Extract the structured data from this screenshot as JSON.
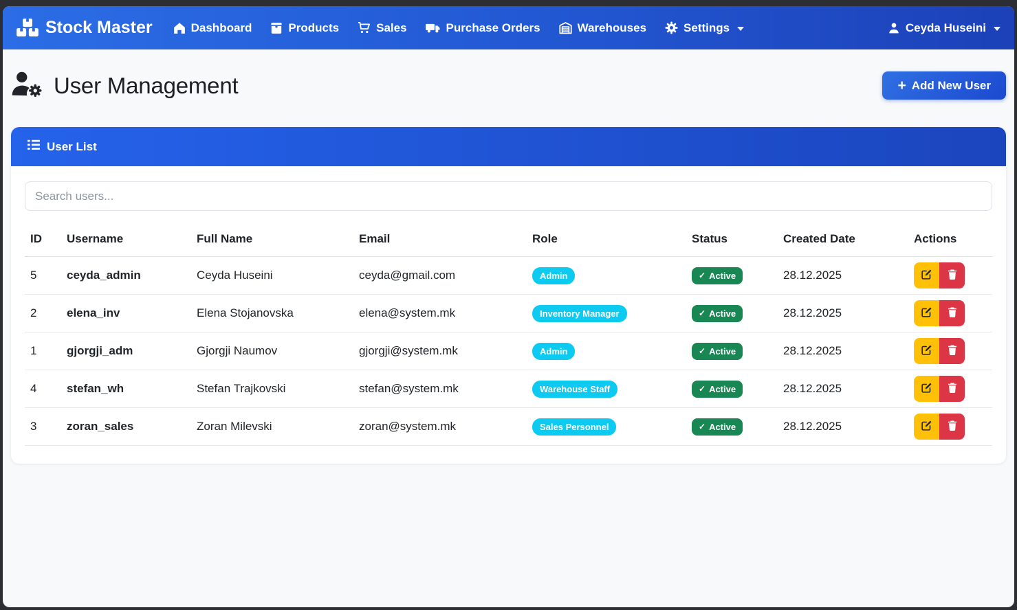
{
  "navbar": {
    "brand": "Stock Master",
    "items": [
      {
        "label": "Dashboard",
        "icon": "house",
        "caret": false
      },
      {
        "label": "Products",
        "icon": "box",
        "caret": false
      },
      {
        "label": "Sales",
        "icon": "cart",
        "caret": false
      },
      {
        "label": "Purchase Orders",
        "icon": "truck",
        "caret": false
      },
      {
        "label": "Warehouses",
        "icon": "garage",
        "caret": false
      },
      {
        "label": "Settings",
        "icon": "gear",
        "caret": true
      }
    ],
    "user": "Ceyda Huseini"
  },
  "page": {
    "title": "User Management",
    "add_button_plus": "+",
    "add_button_label": "Add New User"
  },
  "card": {
    "title": "User List",
    "search_placeholder": "Search users..."
  },
  "table": {
    "columns": [
      "ID",
      "Username",
      "Full Name",
      "Email",
      "Role",
      "Status",
      "Created Date",
      "Actions"
    ],
    "status_check": "✓",
    "rows": [
      {
        "id": "5",
        "username": "ceyda_admin",
        "full_name": "Ceyda Huseini",
        "email": "ceyda@gmail.com",
        "role": "Admin",
        "status": "Active",
        "created_date": "28.12.2025"
      },
      {
        "id": "2",
        "username": "elena_inv",
        "full_name": "Elena Stojanovska",
        "email": "elena@system.mk",
        "role": "Inventory Manager",
        "status": "Active",
        "created_date": "28.12.2025"
      },
      {
        "id": "1",
        "username": "gjorgji_adm",
        "full_name": "Gjorgji Naumov",
        "email": "gjorgji@system.mk",
        "role": "Admin",
        "status": "Active",
        "created_date": "28.12.2025"
      },
      {
        "id": "4",
        "username": "stefan_wh",
        "full_name": "Stefan Trajkovski",
        "email": "stefan@system.mk",
        "role": "Warehouse Staff",
        "status": "Active",
        "created_date": "28.12.2025"
      },
      {
        "id": "3",
        "username": "zoran_sales",
        "full_name": "Zoran Milevski",
        "email": "zoran@system.mk",
        "role": "Sales Personnel",
        "status": "Active",
        "created_date": "28.12.2025"
      }
    ]
  },
  "colors": {
    "navbar_gradient_start": "#2b6de6",
    "navbar_gradient_end": "#1c41b8",
    "accent": "#2563eb",
    "role_badge": "#0dcaf0",
    "status_badge": "#198754",
    "edit_button": "#ffc107",
    "delete_button": "#dc3545",
    "page_background": "#f8f9fa",
    "frame": "#2c2e33"
  }
}
